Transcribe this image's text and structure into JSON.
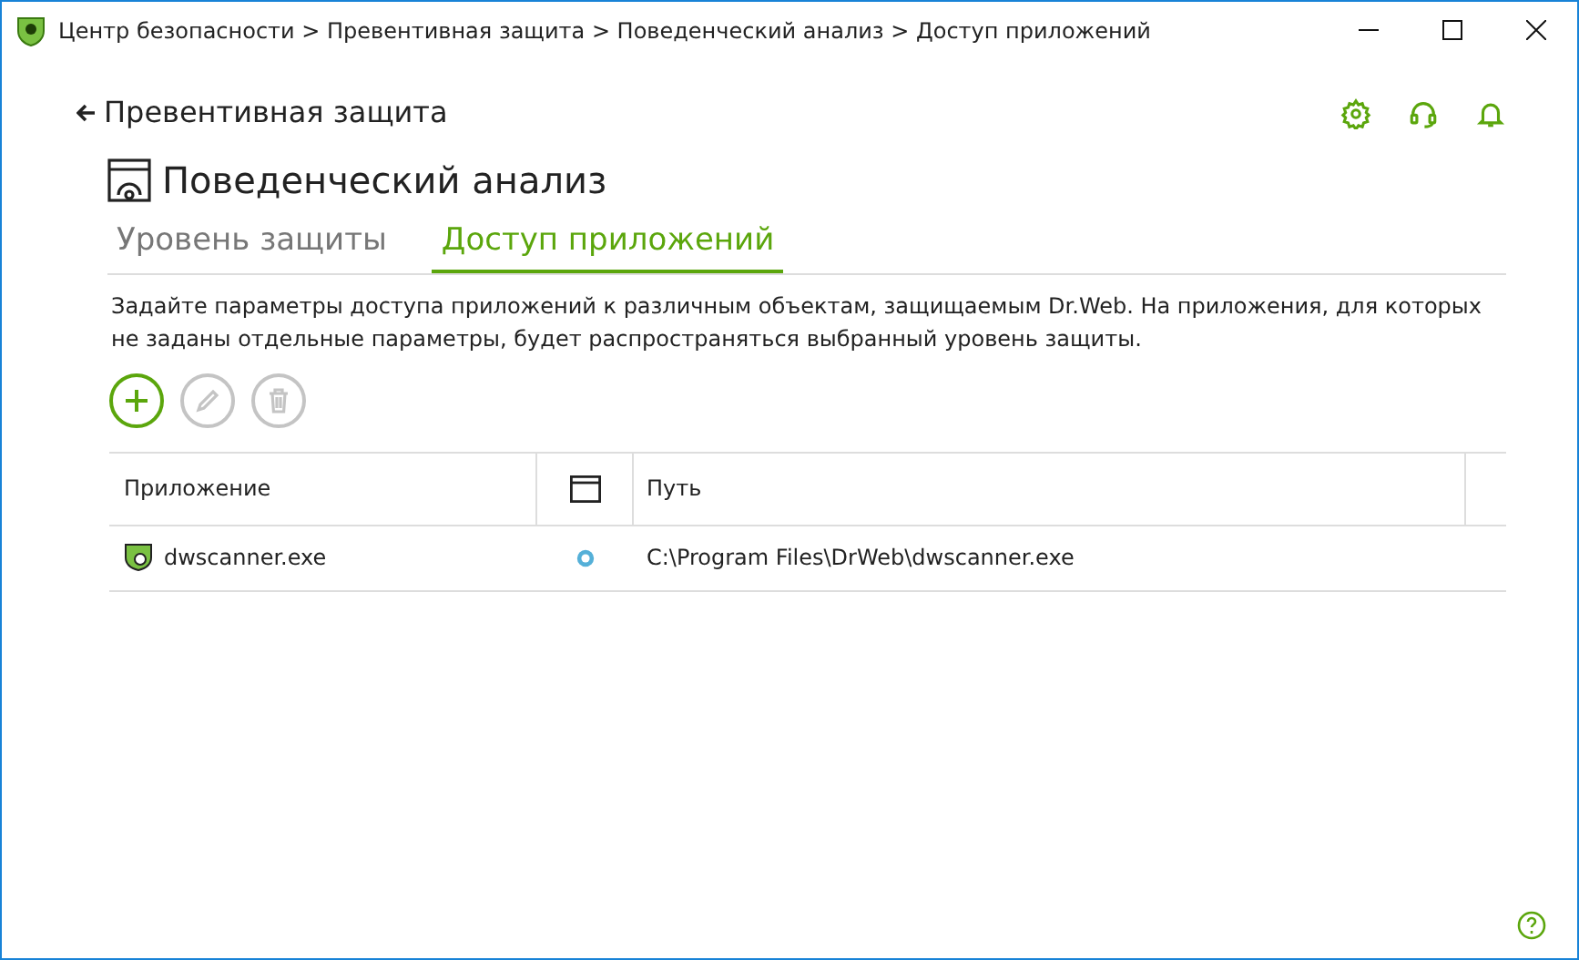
{
  "window": {
    "title": "Центр безопасности > Превентивная защита > Поведенческий анализ > Доступ приложений"
  },
  "back_link": "Превентивная защита",
  "heading": "Поведенческий анализ",
  "tabs": [
    {
      "label": "Уровень защиты",
      "selected": false
    },
    {
      "label": "Доступ приложений",
      "selected": true
    }
  ],
  "description": "Задайте параметры доступа приложений к различным объектам, защищаемым Dr.Web. На приложения, для которых не заданы отдельные параметры, будет распространяться выбранный уровень защиты.",
  "toolbar": [
    {
      "kind": "add",
      "disabled": false
    },
    {
      "kind": "edit",
      "disabled": true
    },
    {
      "kind": "delete",
      "disabled": true
    }
  ],
  "table": {
    "columns": [
      "Приложение",
      "Путь"
    ],
    "rows": [
      {
        "application": "dwscanner.exe",
        "path": "C:\\Program Files\\DrWeb\\dwscanner.exe"
      }
    ]
  }
}
